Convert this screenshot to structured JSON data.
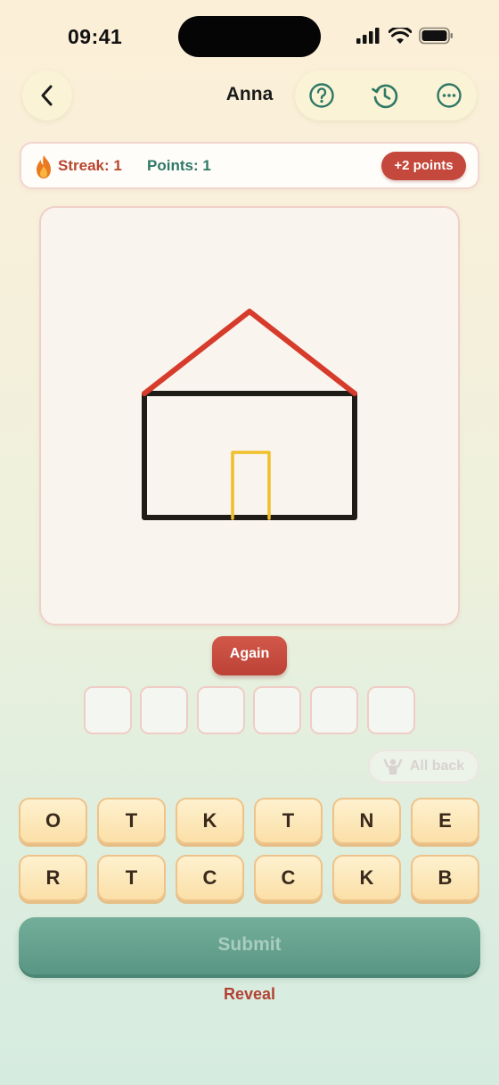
{
  "status_bar": {
    "time": "09:41"
  },
  "header": {
    "title": "Anna",
    "back_icon": "chevron-left-icon",
    "actions": [
      {
        "name": "help",
        "icon": "question-circle-icon"
      },
      {
        "name": "history",
        "icon": "history-clock-icon"
      },
      {
        "name": "more",
        "icon": "more-horizontal-icon"
      }
    ]
  },
  "score": {
    "streak_label": "Streak: 1",
    "points_label": "Points: 1",
    "bonus_badge": "+2 points"
  },
  "canvas": {
    "drawing_subject": "house",
    "stroke_colors": {
      "roof": "#d63b2b",
      "walls": "#1f1b17",
      "door": "#f0bf2a"
    }
  },
  "controls": {
    "again_label": "Again",
    "answer_slots": [
      "",
      "",
      "",
      "",
      "",
      ""
    ],
    "all_back_label": "All back",
    "submit_label": "Submit",
    "reveal_label": "Reveal"
  },
  "letters": {
    "row1": [
      "O",
      "T",
      "K",
      "T",
      "N",
      "E"
    ],
    "row2": [
      "R",
      "T",
      "C",
      "C",
      "K",
      "B"
    ]
  },
  "colors": {
    "accent_red": "#c4483b",
    "accent_green": "#2e7866",
    "submit_green": "#5f9c89",
    "tile_fill": "#fbe6b5"
  }
}
